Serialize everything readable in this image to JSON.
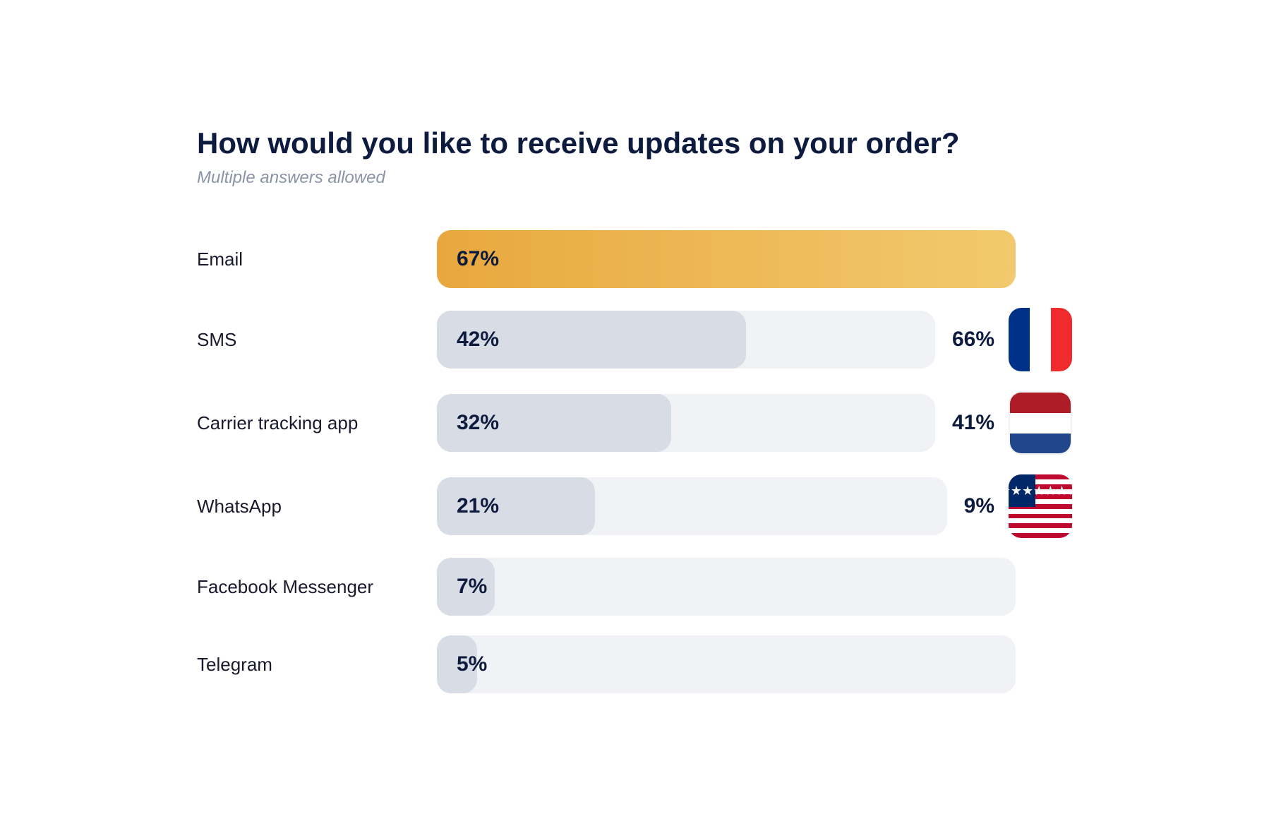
{
  "title": "How would you like to receive updates on your order?",
  "subtitle": "Multiple answers allowed",
  "bars": [
    {
      "id": "email",
      "label": "Email",
      "mainPercent": "67%",
      "fillWidth": 100,
      "style": "gradient",
      "sidePercent": null,
      "flag": null
    },
    {
      "id": "sms",
      "label": "SMS",
      "mainPercent": "42%",
      "fillWidth": 62,
      "style": "gray",
      "sidePercent": "66%",
      "flag": "fr"
    },
    {
      "id": "carrier",
      "label": "Carrier tracking app",
      "mainPercent": "32%",
      "fillWidth": 47,
      "style": "gray",
      "sidePercent": "41%",
      "flag": "nl"
    },
    {
      "id": "whatsapp",
      "label": "WhatsApp",
      "mainPercent": "21%",
      "fillWidth": 31,
      "style": "gray",
      "sidePercent": "9%",
      "flag": "us"
    },
    {
      "id": "facebook",
      "label": "Facebook Messenger",
      "mainPercent": "7%",
      "fillWidth": 10,
      "style": "gray",
      "sidePercent": null,
      "flag": null
    },
    {
      "id": "telegram",
      "label": "Telegram",
      "mainPercent": "5%",
      "fillWidth": 7,
      "style": "gray",
      "sidePercent": null,
      "flag": null
    }
  ]
}
